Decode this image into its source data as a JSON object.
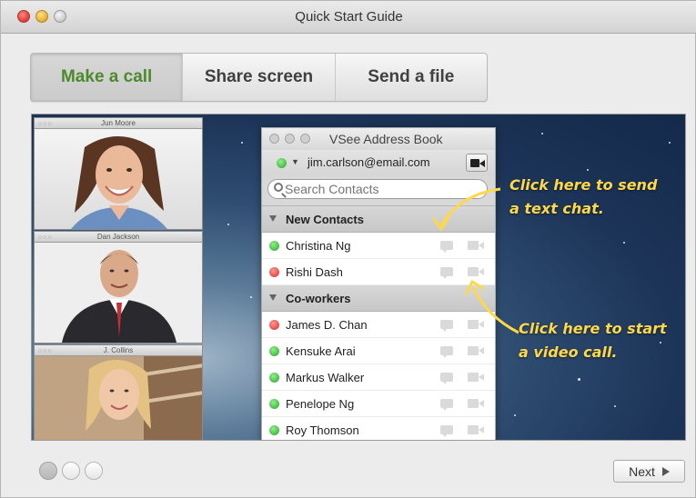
{
  "window": {
    "title": "Quick Start Guide"
  },
  "tabs": [
    {
      "label": "Make a call",
      "active": true
    },
    {
      "label": "Share screen",
      "active": false
    },
    {
      "label": "Send a file",
      "active": false
    }
  ],
  "video_windows": [
    {
      "name": "Jun Moore"
    },
    {
      "name": "Dan Jackson"
    },
    {
      "name": "J. Collins"
    }
  ],
  "address_book": {
    "title": "VSee Address Book",
    "account_email": "jim.carlson@email.com",
    "account_status": "online",
    "search_placeholder": "Search Contacts",
    "groups": [
      {
        "label": "New Contacts",
        "contacts": [
          {
            "name": "Christina Ng",
            "status": "online"
          },
          {
            "name": "Rishi Dash",
            "status": "busy"
          }
        ]
      },
      {
        "label": "Co-workers",
        "contacts": [
          {
            "name": "James D. Chan",
            "status": "busy"
          },
          {
            "name": "Kensuke Arai",
            "status": "online"
          },
          {
            "name": "Markus Walker",
            "status": "online"
          },
          {
            "name": "Penelope Ng",
            "status": "online"
          },
          {
            "name": "Roy Thomson",
            "status": "online"
          }
        ]
      }
    ]
  },
  "annotations": {
    "chat_line1": "Click here to send",
    "chat_line2": "a text chat.",
    "video_line1": "Click here to start",
    "video_line2": "a video call."
  },
  "pager": {
    "pages": 3,
    "current": 1
  },
  "footer": {
    "next_label": "Next"
  },
  "colors": {
    "active_tab": "#4c8a2c",
    "annotation": "#ffd84a",
    "online": "#2ea32a",
    "busy": "#d32a23"
  }
}
